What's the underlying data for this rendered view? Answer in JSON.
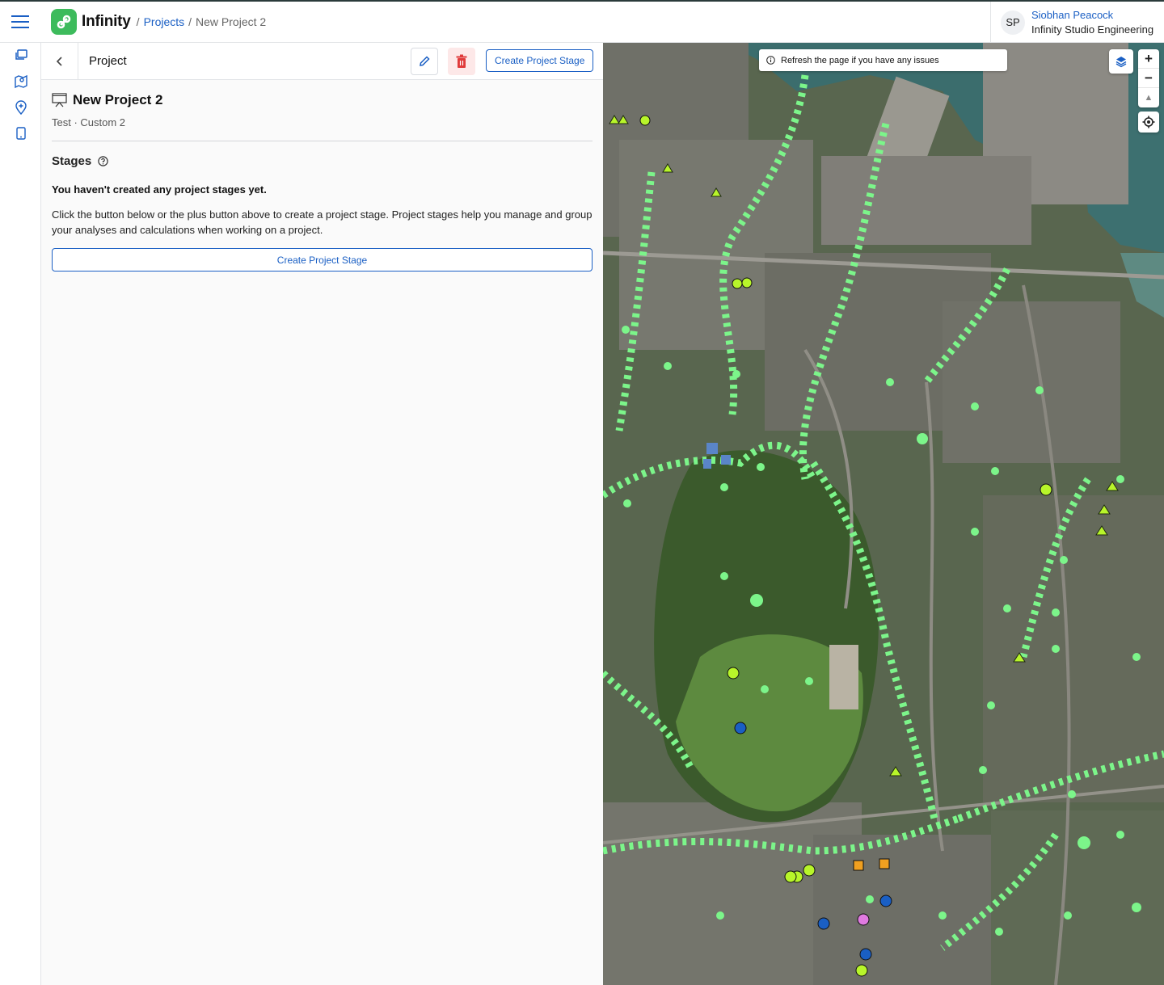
{
  "app": {
    "name": "Infinity"
  },
  "breadcrumb": {
    "projects": "Projects",
    "separator": "/",
    "current": "New Project 2"
  },
  "user": {
    "initials": "SP",
    "name": "Siobhan Peacock",
    "organization": "Infinity Studio Engineering"
  },
  "panel": {
    "title": "Project",
    "create_stage_label": "Create Project Stage",
    "project_name": "New Project 2",
    "project_meta": "Test · Custom 2",
    "stages_title": "Stages",
    "empty_title": "You haven't created any project stages yet.",
    "empty_desc": "Click the button below or the plus button above to create a project stage. Project stages help you manage and group your analyses and calculations when working on a project.",
    "create_stage_button": "Create Project Stage"
  },
  "map": {
    "notice": "Refresh the page if you have any issues",
    "zoom_in": "+",
    "zoom_out": "−",
    "compass": "▲"
  },
  "colors": {
    "accent": "#1a5fc4",
    "brand": "#3dbb5c",
    "danger": "#e03a3a",
    "map_marker": "#7cf58a"
  },
  "icons": {
    "menu": "hamburger-icon",
    "projects": "projects-icon",
    "map": "map-icon",
    "add_location": "add-location-icon",
    "device": "tablet-icon",
    "back": "chevron-left-icon",
    "edit": "pencil-icon",
    "delete": "trash-icon",
    "project": "project-monitor-icon",
    "help": "help-icon",
    "info": "info-icon",
    "layers": "layers-icon",
    "locate": "locate-icon"
  }
}
